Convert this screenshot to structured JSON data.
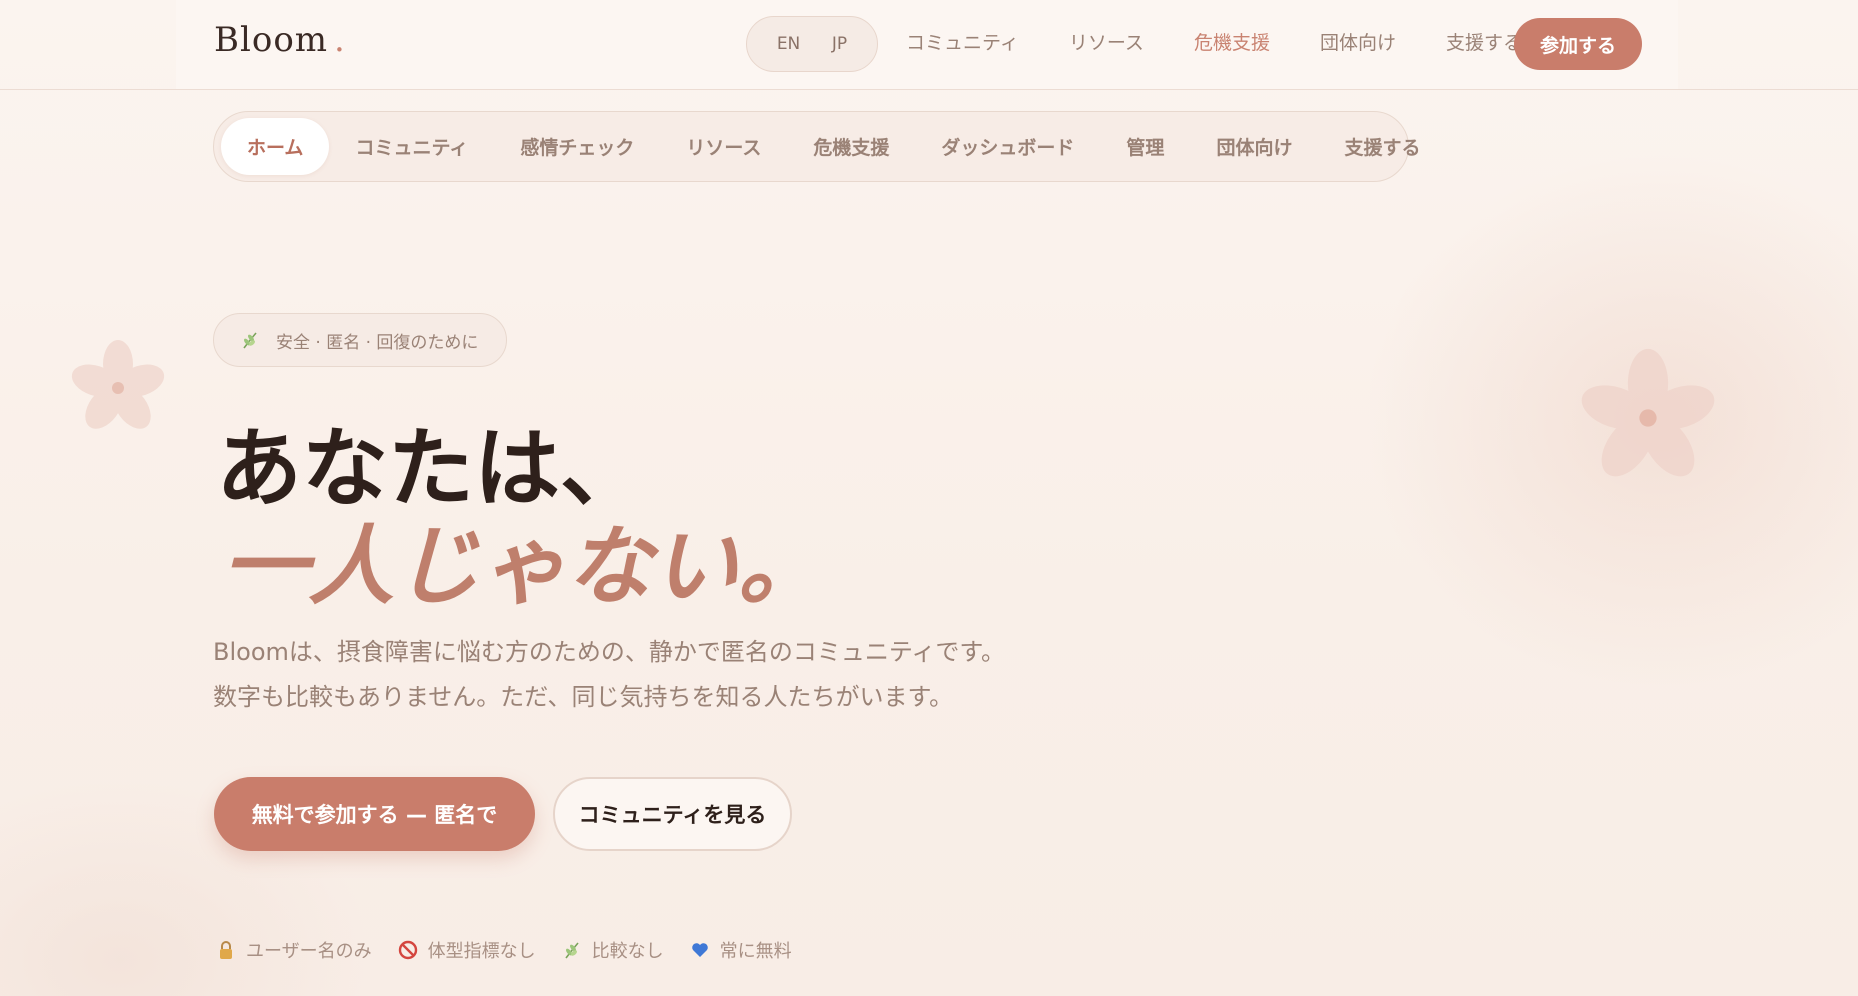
{
  "brand": {
    "name": "Bloom",
    "dot": "."
  },
  "language": {
    "options": [
      "EN",
      "JP"
    ]
  },
  "top_nav": {
    "items": [
      {
        "label": "コミュニティ",
        "accent": false
      },
      {
        "label": "リソース",
        "accent": false
      },
      {
        "label": "危機支援",
        "accent": true
      },
      {
        "label": "団体向け",
        "accent": false
      },
      {
        "label": "支援する",
        "accent": false
      }
    ],
    "join_label": "参加する"
  },
  "sub_nav": {
    "items": [
      "ホーム",
      "コミュニティ",
      "感情チェック",
      "リソース",
      "危機支援",
      "ダッシュボード",
      "管理",
      "団体向け",
      "支援する"
    ],
    "active_index": 0
  },
  "hero": {
    "badge": "安全 · 匿名 · 回復のために",
    "title_line1": "あなたは、",
    "title_line2": "一人じゃない。",
    "description_line1": "Bloomは、摂食障害に悩む方のための、静かで匿名のコミュニティです。",
    "description_line2": "数字も比較もありません。ただ、同じ気持ちを知る人たちがいます。",
    "primary_cta": "無料で参加する — 匿名で",
    "secondary_cta": "コミュニティを見る"
  },
  "features": [
    {
      "icon": "lock-icon",
      "label": "ユーザー名のみ"
    },
    {
      "icon": "prohibited-icon",
      "label": "体型指標なし"
    },
    {
      "icon": "herb-icon",
      "label": "比較なし"
    },
    {
      "icon": "blue-heart-icon",
      "label": "常に無料"
    }
  ],
  "colors": {
    "accent": "#c97d6b",
    "background": "#faf1eb",
    "text_muted": "#9a8276",
    "heading": "#2e201b",
    "heading_accent": "#bf7f6c"
  }
}
